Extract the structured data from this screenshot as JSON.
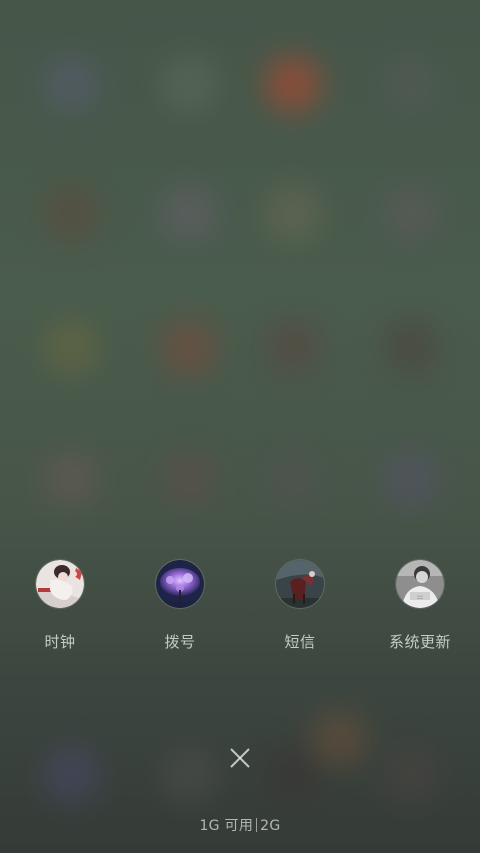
{
  "recents": [
    {
      "label": "时钟",
      "icon": "clock-app-thumbnail-icon"
    },
    {
      "label": "拨号",
      "icon": "dialer-app-thumbnail-icon"
    },
    {
      "label": "短信",
      "icon": "messages-app-thumbnail-icon"
    },
    {
      "label": "系统更新",
      "icon": "system-update-app-thumbnail-icon"
    }
  ],
  "close": {
    "icon": "close-icon"
  },
  "memory": {
    "available": "1G 可用",
    "total": "2G"
  },
  "colors": {
    "background": "#465649",
    "label": "#ebeeeb"
  }
}
